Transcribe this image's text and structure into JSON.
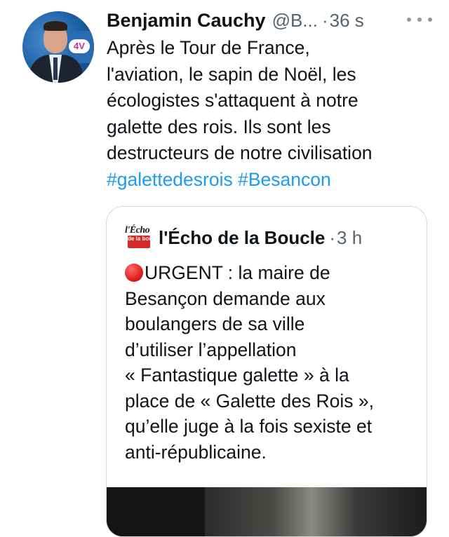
{
  "tweet": {
    "author": {
      "display_name": "Benjamin Cauchy",
      "handle": "@B...",
      "avatar_badge": "4V"
    },
    "separator": "·",
    "time": "36 s",
    "text_lines": [
      "Après le Tour de France,",
      "l'aviation, le sapin de Noël, les",
      "écologistes s'attaquent à notre",
      "galette des rois. Ils sont les",
      "destructeurs de notre civilisation"
    ],
    "hashtags": [
      "#galettedesrois",
      "#Besancon"
    ]
  },
  "quoted_tweet": {
    "logo": {
      "top": "l'Écho",
      "bottom": "de la boucle"
    },
    "author": "l'Écho de la Boucle",
    "separator": "·",
    "time": "3 h",
    "text_lines": [
      "URGENT : la maire de",
      "Besançon demande aux",
      "boulangers de sa ville",
      "d’utiliser l’appellation",
      "« Fantastique galette » à la",
      "place de « Galette des Rois »,",
      "qu’elle juge à la fois sexiste et",
      "anti-républicaine."
    ]
  },
  "colors": {
    "text": "#0f1419",
    "secondary": "#536471",
    "link": "#1d9bf0",
    "border": "#cfd9de",
    "urgent_red": "#e02020"
  },
  "icons": {
    "more": "more-horizontal-icon",
    "urgent": "red-circle-icon"
  }
}
